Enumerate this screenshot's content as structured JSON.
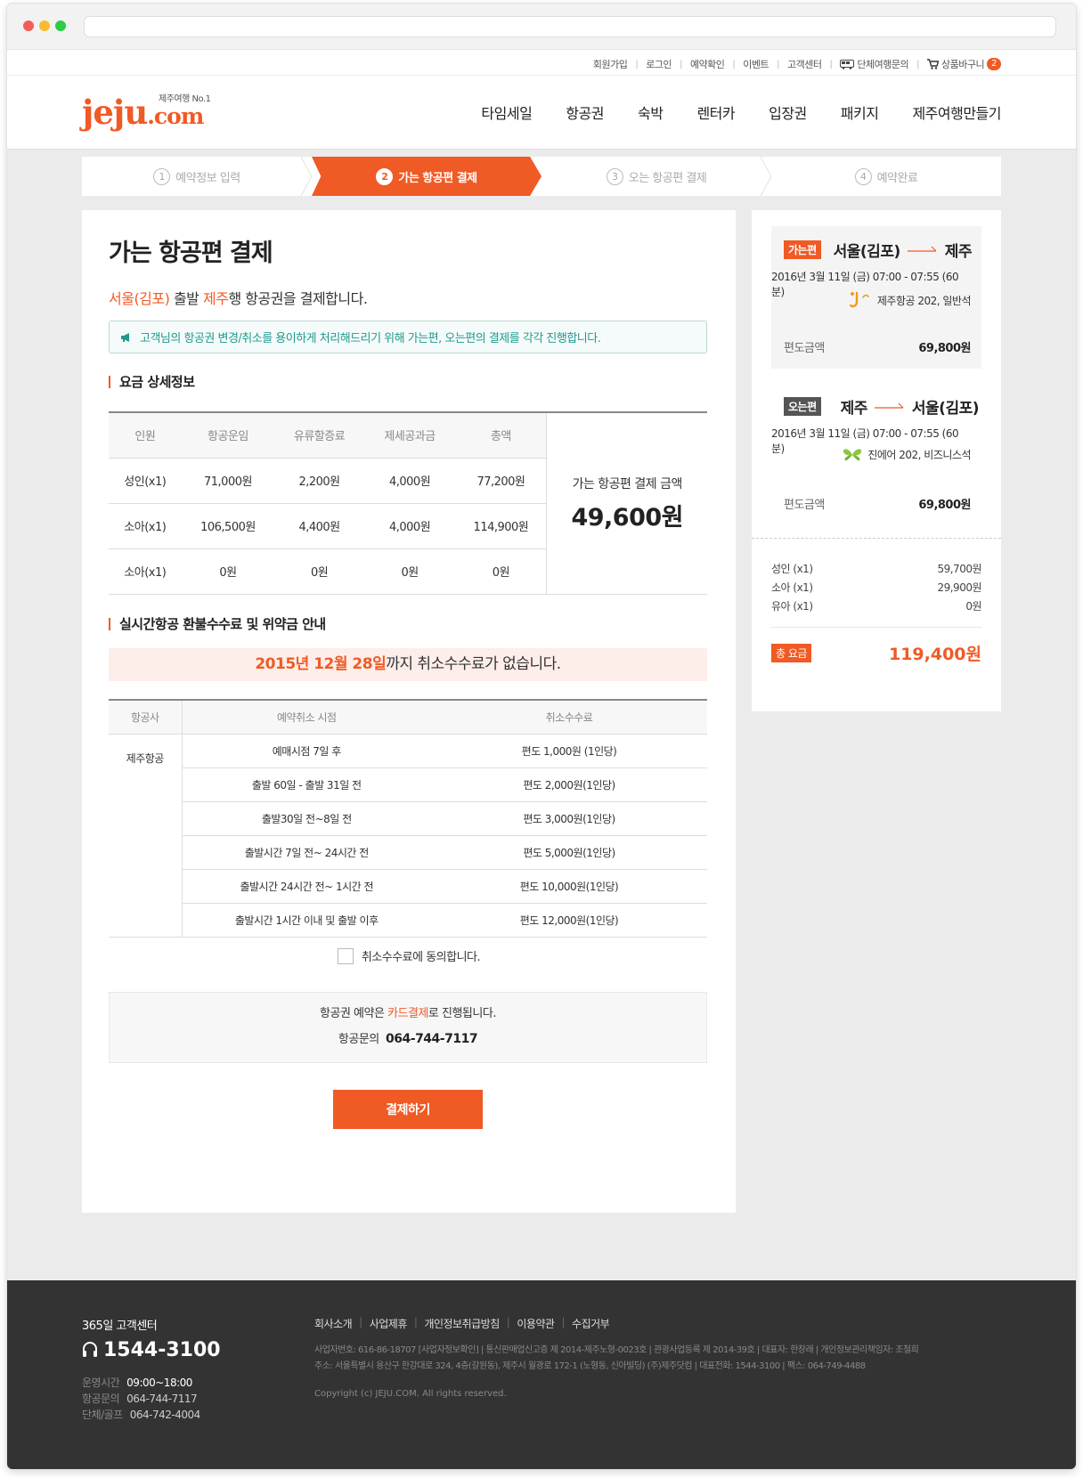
{
  "topbar": {
    "links": [
      "회원가입",
      "로그인",
      "예약확인",
      "이벤트",
      "고객센터",
      "단체여행문의",
      "상품바구니"
    ],
    "cart_count": "2"
  },
  "logo": {
    "text": "jeju",
    "suffix": ".com",
    "tagline": "제주여행 No.1"
  },
  "nav": [
    "타임세일",
    "항공권",
    "숙박",
    "렌터카",
    "입장권",
    "패키지",
    "제주여행만들기"
  ],
  "steps": [
    {
      "num": "1",
      "label": "예약정보 입력"
    },
    {
      "num": "2",
      "label": "가는 항공편 결제"
    },
    {
      "num": "3",
      "label": "오는 항공편 결제"
    },
    {
      "num": "4",
      "label": "예약완료"
    }
  ],
  "main": {
    "title": "가는 항공편 결제",
    "intro": {
      "from": "서울(김포)",
      "mid": " 출발 ",
      "to": "제주",
      "rest": "행 항공권을 결제합니다."
    },
    "notice": "고객님의 항공권 변경/취소를 용이하게 처리해드리기 위해 가는편, 오는편의 결제를 각각 진행합니다.",
    "fare_section": "요금 상세정보",
    "fare_headers": [
      "인원",
      "항공운임",
      "유류할증료",
      "제세공과금",
      "총액"
    ],
    "fare_rows": [
      [
        "성인(x1)",
        "71,000원",
        "2,200원",
        "4,000원",
        "77,200원"
      ],
      [
        "소아(x1)",
        "106,500원",
        "4,400원",
        "4,000원",
        "114,900원"
      ],
      [
        "소아(x1)",
        "0원",
        "0원",
        "0원",
        "0원"
      ]
    ],
    "fare_total_label": "가는 항공편 결제 금액",
    "fare_total_value": "49,600원",
    "refund_section": "실시간항공 환불수수료 및 위약금 안내",
    "refund_date": "2015년 12월 28일",
    "refund_text": "까지 취소수수료가 없습니다.",
    "cancel_headers": [
      "항공사",
      "예약취소 시점",
      "취소수수료"
    ],
    "cancel_airline": "제주항공",
    "cancel_rows": [
      [
        "예매시점 7일 후",
        "편도 1,000원 (1인당)"
      ],
      [
        "출발 60일 - 출발 31일 전",
        "편도 2,000원(1인당)"
      ],
      [
        "출발30일 전~8일 전",
        "편도 3,000원(1인당)"
      ],
      [
        "출발시간 7일 전~ 24시간 전",
        "편도 5,000원(1인당)"
      ],
      [
        "출발시간 24시간 전~ 1시간 전",
        "편도 10,000원(1인당)"
      ],
      [
        "출발시간 1시간 이내 및 출발 이후",
        "편도 12,000원(1인당)"
      ]
    ],
    "agree_label": "취소수수료에 동의합니다.",
    "pay_info": {
      "pre": "항공권 예약은 ",
      "highlight": "카드결제",
      "post": "로 진행됩니다.",
      "phone_label": "항공문의",
      "phone": "064-744-7117"
    },
    "pay_button": "결제하기"
  },
  "side": {
    "outbound": {
      "tag": "가는편",
      "from": "서울(김포)",
      "to": "제주",
      "date": "2016년 3월 11일 (금) 07:00 - 07:55 (60분)",
      "airline": "제주항공 202, 일반석",
      "price_label": "편도금액",
      "price": "69,800원"
    },
    "inbound": {
      "tag": "오는편",
      "from": "제주",
      "to": "서울(김포)",
      "date": "2016년 3월 11일 (금) 07:00 - 07:55 (60분)",
      "airline": "진에어 202, 비즈니스석",
      "price_label": "편도금액",
      "price": "69,800원"
    },
    "pax": [
      {
        "label": "성인 (x1)",
        "value": "59,700원"
      },
      {
        "label": "소아 (x1)",
        "value": "29,900원"
      },
      {
        "label": "유아 (x1)",
        "value": "0원"
      }
    ],
    "total_tag": "총 요금",
    "total": "119,400원"
  },
  "footer": {
    "cc_title": "365일 고객센터",
    "cc_phone": "1544-3100",
    "hours": [
      {
        "label": "운영시간",
        "value": "09:00~18:00"
      },
      {
        "label": "항공문의",
        "value": "064-744-7117"
      },
      {
        "label": "단체/골프",
        "value": "064-742-4004"
      }
    ],
    "links": [
      "회사소개",
      "사업제휴",
      "개인정보취급방침",
      "이용약관",
      "수집거부"
    ],
    "info1": "사업자번호: 616-86-18707 [사업자정보확인] | 통신판매업신고증 제 2014-제주노형-0023호 | 관광사업등록 제 2014-39호 | 대표자: 한창래 | 개인정보관리책임자: 조철희",
    "info2": "주소: 서울특별시 용산구 한강대로 324, 4층(갈원동), 제주시 월광로 172-1 (노형동, 신아빌딩) (주)제주닷컴 | 대표전화: 1544-3100 | 팩스: 064-749-4488",
    "copyright": "Copyright (c) JEJU.COM. All rights reserved."
  },
  "colors": {
    "accent": "#f05a24",
    "teal": "#1e9a8f",
    "dark_footer": "#333333"
  }
}
